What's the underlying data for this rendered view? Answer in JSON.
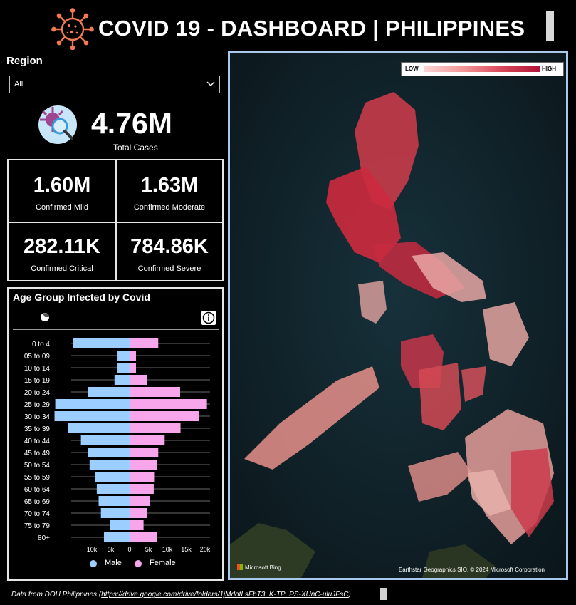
{
  "header": {
    "title": "COVID 19 - DASHBOARD | PHILIPPINES"
  },
  "filter": {
    "label": "Region",
    "selected": "All"
  },
  "total": {
    "value": "4.76M",
    "label": "Total Cases"
  },
  "cards": [
    {
      "value": "1.60M",
      "label": "Confirmed Mild"
    },
    {
      "value": "1.63M",
      "label": "Confirmed Moderate"
    },
    {
      "value": "282.11K",
      "label": "Confirmed Critical"
    },
    {
      "value": "784.86K",
      "label": "Confirmed Severe"
    }
  ],
  "age_panel": {
    "title": "Age Group Infected by Covid"
  },
  "chart_data": {
    "type": "bar",
    "orientation": "horizontal",
    "layout": "population-pyramid",
    "categories": [
      "0 to 4",
      "05 to 09",
      "10 to 14",
      "15 to 19",
      "20 to 24",
      "25 to 29",
      "30 to 34",
      "35 to 39",
      "40 to 44",
      "45 to 49",
      "50 to 54",
      "55 to 59",
      "60 to 64",
      "65 to 69",
      "70 to 74",
      "75 to 79",
      "80+"
    ],
    "series": [
      {
        "name": "Male",
        "color": "#9ccfff",
        "values": [
          14900,
          3200,
          3200,
          4000,
          11000,
          19700,
          19900,
          16300,
          12900,
          11100,
          10600,
          9100,
          8700,
          8200,
          7600,
          5200,
          6800
        ]
      },
      {
        "name": "Female",
        "color": "#f8a6ec",
        "values": [
          7600,
          1700,
          1700,
          4700,
          13400,
          20500,
          18400,
          13500,
          9300,
          7600,
          7300,
          6500,
          6400,
          5400,
          4600,
          3700,
          7200
        ]
      }
    ],
    "x_ticks": [
      "10k",
      "5k",
      "0",
      "5k",
      "10k",
      "15k",
      "20k"
    ],
    "xlim": [
      -20000,
      20000
    ],
    "legend_position": "bottom"
  },
  "map": {
    "legend_low": "LOW",
    "legend_high": "HIGH",
    "attribution_left": "Microsoft Bing",
    "attribution_right": "Earthstar Geographics SIO, © 2024 Microsoft Corporation"
  },
  "footer": {
    "prefix": "Data from DOH Philippines (",
    "link": "https://drive.google.com/drive/folders/1jMdotLsFbT3_K-TP_PS-XUnC-uluJFsC",
    "suffix": ")"
  }
}
